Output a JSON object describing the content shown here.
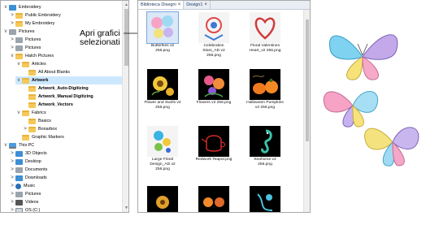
{
  "tree": {
    "items": [
      {
        "label": "Embroidery",
        "chevron": "v",
        "icon": "blue",
        "depth": 0
      },
      {
        "label": "Public Embroidery",
        "chevron": ">",
        "icon": "folder",
        "depth": 1
      },
      {
        "label": "My Embroidery",
        "chevron": ">",
        "icon": "folder",
        "depth": 1
      },
      {
        "label": "Pictures",
        "chevron": "v",
        "icon": "grey",
        "depth": 0
      },
      {
        "label": "Pictures",
        "chevron": ">",
        "icon": "grey",
        "depth": 1
      },
      {
        "label": "Pictures",
        "chevron": ">",
        "icon": "grey",
        "depth": 1
      },
      {
        "label": "Hatch Pictures",
        "chevron": "v",
        "icon": "folder",
        "depth": 1
      },
      {
        "label": "Articles",
        "chevron": "v",
        "icon": "folder",
        "depth": 2
      },
      {
        "label": "All About Blanks",
        "chevron": "",
        "icon": "folder",
        "depth": 3
      },
      {
        "label": "Artwork",
        "chevron": "v",
        "icon": "folder",
        "depth": 2,
        "selected": true,
        "bold": true
      },
      {
        "label": "Artwork_Auto-Digitizing",
        "chevron": "",
        "icon": "folder",
        "depth": 3,
        "bold": true
      },
      {
        "label": "Artwork_Manual Digitizing",
        "chevron": "",
        "icon": "folder",
        "depth": 3,
        "bold": true
      },
      {
        "label": "Artwork_Vectors",
        "chevron": "",
        "icon": "folder",
        "depth": 3,
        "bold": true
      },
      {
        "label": "Fabrics",
        "chevron": "v",
        "icon": "folder",
        "depth": 2
      },
      {
        "label": "Basics",
        "chevron": "",
        "icon": "folder",
        "depth": 3
      },
      {
        "label": "Bonarbox",
        "chevron": ">",
        "icon": "folder",
        "depth": 3
      },
      {
        "label": "Graphic Markers",
        "chevron": "",
        "icon": "folder",
        "depth": 2
      },
      {
        "label": "This PC",
        "chevron": "v",
        "icon": "pc",
        "depth": 0
      },
      {
        "label": "3D Objects",
        "chevron": ">",
        "icon": "blue",
        "depth": 1
      },
      {
        "label": "Desktop",
        "chevron": ">",
        "icon": "blue",
        "depth": 1
      },
      {
        "label": "Documents",
        "chevron": ">",
        "icon": "grey",
        "depth": 1
      },
      {
        "label": "Downloads",
        "chevron": ">",
        "icon": "blue",
        "depth": 1
      },
      {
        "label": "Music",
        "chevron": ">",
        "icon": "music",
        "depth": 1
      },
      {
        "label": "Pictures",
        "chevron": ">",
        "icon": "grey",
        "depth": 1
      },
      {
        "label": "Videos",
        "chevron": ">",
        "icon": "dark",
        "depth": 1
      },
      {
        "label": "OS (C:)",
        "chevron": ">",
        "icon": "drive",
        "depth": 1
      }
    ]
  },
  "callout": {
    "line1": "Apri grafici",
    "line2": "selezionati"
  },
  "library": {
    "tabs": [
      {
        "label": "Biblioteca Disegni",
        "active": true
      },
      {
        "label": "Design1",
        "active": false
      }
    ],
    "tiles": [
      {
        "caption": "Butterflies v2 256.png",
        "bg": "sel",
        "art": "butterflies"
      },
      {
        "caption": "Celebration Stars_AD v2 256.png",
        "bg": "light",
        "art": "stars"
      },
      {
        "caption": "Floral Valentines Heart_v2 256.png",
        "bg": "light",
        "art": "heart"
      },
      {
        "caption": "Flower and Swirls v2 256.png",
        "bg": "dark",
        "art": "sunflower"
      },
      {
        "caption": "Flowers v2 256.png",
        "bg": "dark",
        "art": "flowers"
      },
      {
        "caption": "Halloween Pumpkins v2 256.png",
        "bg": "dark",
        "art": "pumpkins"
      },
      {
        "caption": "Large Floral Design_AD v2 256.png",
        "bg": "light",
        "art": "floral"
      },
      {
        "caption": "Redwork Teapot.png",
        "bg": "dark",
        "art": "teapot"
      },
      {
        "caption": "Seahorse v2 256.png",
        "bg": "dark",
        "art": "seahorse"
      },
      {
        "caption": "",
        "bg": "dark",
        "art": "partial1"
      },
      {
        "caption": "",
        "bg": "dark",
        "art": "partial2"
      },
      {
        "caption": "",
        "bg": "dark",
        "art": "partial3"
      }
    ]
  },
  "colors": {
    "selection": "#cce8ff",
    "folder": "#f5c85a",
    "tab_bar": "#e9eef5"
  }
}
